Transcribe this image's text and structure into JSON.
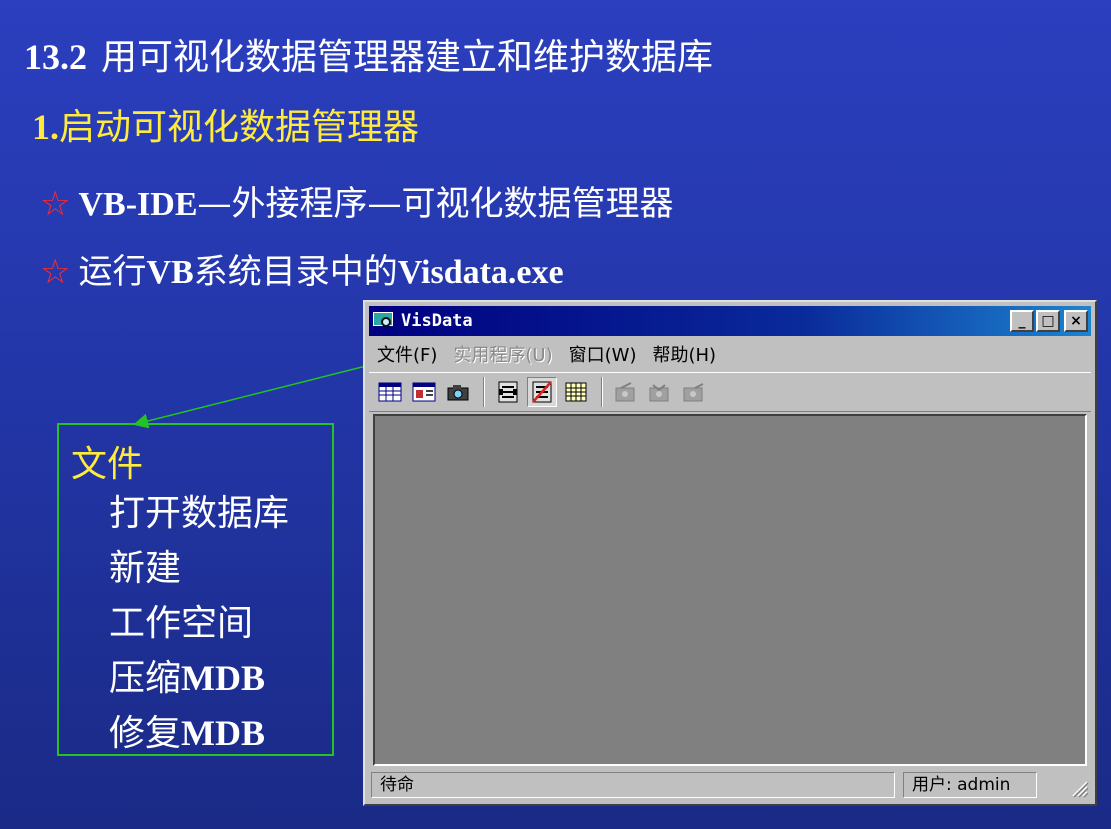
{
  "slide": {
    "section_number": "13.2",
    "title": "用可视化数据管理器建立和维护数据库",
    "sub_number": "1.",
    "subtitle": "启动可视化数据管理器",
    "bullets": [
      {
        "star": "☆",
        "part1": "VB-IDE",
        "part2": "—外接程序—可视化数据管理器"
      },
      {
        "star": "☆",
        "part1": "运行",
        "part2": "VB",
        "part3": "系统目录中的",
        "part4": "Visdata.exe"
      }
    ],
    "file_menu_box": {
      "heading": "文件",
      "items": [
        {
          "cn": "打开数据库",
          "lat": ""
        },
        {
          "cn": "新建",
          "lat": ""
        },
        {
          "cn": "工作空间",
          "lat": ""
        },
        {
          "cn": "压缩",
          "lat": "MDB"
        },
        {
          "cn": "修复",
          "lat": "MDB"
        }
      ],
      "border_color": "#22c322"
    }
  },
  "window": {
    "title": "VisData",
    "minimize": "_",
    "maximize": "□",
    "close": "×",
    "menu": [
      {
        "label": "文件(F)",
        "enabled": true
      },
      {
        "label": "实用程序(U)",
        "enabled": false
      },
      {
        "label": "窗口(W)",
        "enabled": true
      },
      {
        "label": "帮助(H)",
        "enabled": true
      }
    ],
    "toolbar_icons": [
      "table-icon",
      "dynaset-icon",
      "snapshot-icon",
      "data-control-icon",
      "no-data-control-icon",
      "grid-icon",
      "begin-transaction-icon",
      "rollback-icon",
      "commit-icon"
    ],
    "status_left": "待命",
    "status_right": "用户: admin"
  }
}
